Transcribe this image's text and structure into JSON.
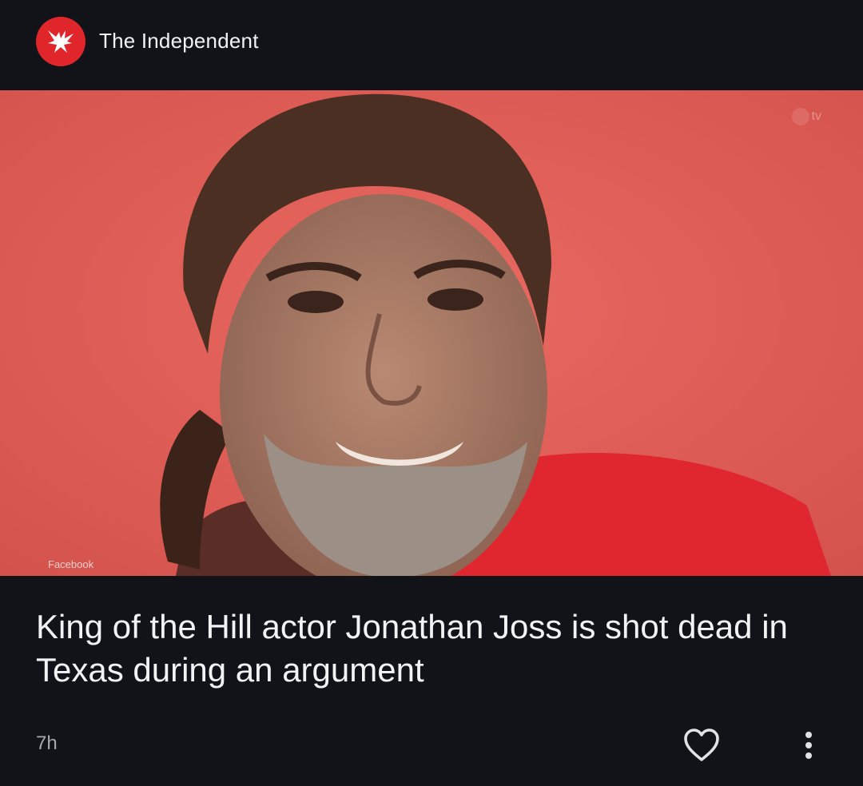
{
  "publisher": {
    "name": "The Independent",
    "logo_icon": "independent-eagle-icon",
    "logo_color": "#e0262b"
  },
  "article": {
    "image_credit": "Facebook",
    "image_watermark": "tv",
    "headline": "King of the Hill actor Jonathan Joss is shot dead in Texas during an argument",
    "time_ago": "7h"
  },
  "actions": {
    "like_icon": "heart-outline-icon",
    "more_icon": "more-vertical-icon"
  },
  "colors": {
    "background": "#111318",
    "text_primary": "#f3f3f5",
    "text_secondary": "#a8a9ad"
  }
}
